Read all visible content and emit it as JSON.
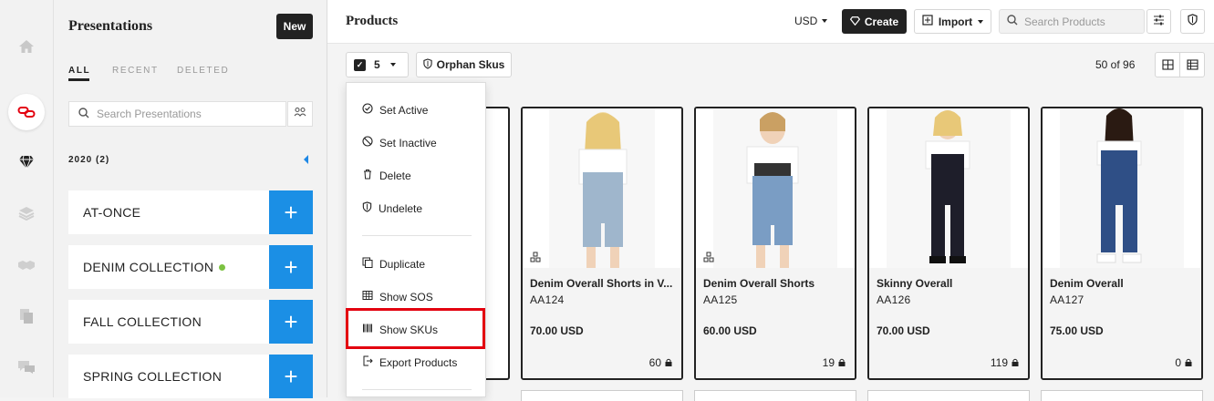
{
  "rail": {
    "icons": [
      "home-icon",
      "chain-link-icon",
      "diamond-icon",
      "layers-icon",
      "handshake-icon",
      "copy-icon",
      "chat-icon"
    ]
  },
  "presentations": {
    "title": "Presentations",
    "new_label": "New",
    "tabs": [
      "ALL",
      "RECENT",
      "DELETED"
    ],
    "search_placeholder": "Search Presentations",
    "year_group": "2020 (2)",
    "items": [
      {
        "label": "AT-ONCE",
        "dot": false
      },
      {
        "label": "DENIM COLLECTION",
        "dot": true
      },
      {
        "label": "FALL COLLECTION",
        "dot": false
      },
      {
        "label": "SPRING COLLECTION",
        "dot": false
      }
    ],
    "plus": "+"
  },
  "header": {
    "title": "Products",
    "currency": "USD",
    "create_label": "Create",
    "import_label": "Import",
    "search_placeholder": "Search Products"
  },
  "toolbar": {
    "selected_count": "5",
    "orphan_label": "Orphan Skus",
    "count_text": "50 of 96"
  },
  "menu": {
    "items": [
      {
        "label": "Set Active",
        "icon": "check-circle-icon"
      },
      {
        "label": "Set Inactive",
        "icon": "ban-icon"
      },
      {
        "label": "Delete",
        "icon": "trash-icon"
      },
      {
        "label": "Undelete",
        "icon": "shield-icon"
      },
      {
        "label": "Duplicate",
        "icon": "duplicate-icon"
      },
      {
        "label": "Show SOS",
        "icon": "table-icon"
      },
      {
        "label": "Show SKUs",
        "icon": "barcode-icon"
      },
      {
        "label": "Export Products",
        "icon": "export-icon"
      }
    ],
    "highlight_color": "#e3000f"
  },
  "products": [
    {
      "name": "Denim Overall Shorts in V...",
      "sku": "AA124",
      "price": "70.00 USD",
      "stock": "60",
      "bundle": true,
      "top_color": "#ffffff",
      "pants_color": "#9fb6cc"
    },
    {
      "name": "Denim Overall Shorts",
      "sku": "AA125",
      "price": "60.00 USD",
      "stock": "19",
      "bundle": true,
      "top_color": "#ffffff",
      "pants_color": "#7a9dc4"
    },
    {
      "name": "Skinny Overall",
      "sku": "AA126",
      "price": "70.00 USD",
      "stock": "119",
      "bundle": false,
      "top_color": "#ffffff",
      "pants_color": "#1e1e2a"
    },
    {
      "name": "Denim Overall",
      "sku": "AA127",
      "price": "75.00 USD",
      "stock": "0",
      "bundle": false,
      "top_color": "#ffffff",
      "pants_color": "#2f4f86"
    }
  ],
  "colors": {
    "accent_blue": "#1b8fe5",
    "status_green": "#7cc242",
    "dark": "#222222"
  }
}
